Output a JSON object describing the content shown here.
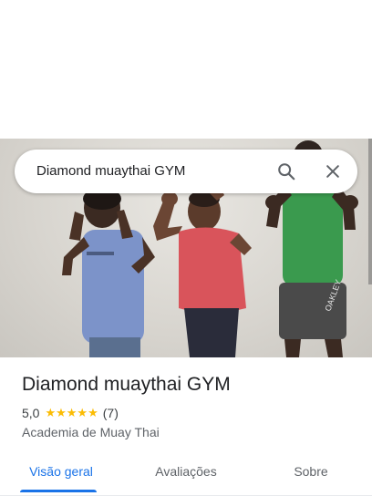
{
  "search": {
    "query": "Diamond muaythai GYM"
  },
  "icons": {
    "search": "search-icon",
    "close": "close-icon",
    "star": "star-icon"
  },
  "place": {
    "name": "Diamond muaythai GYM",
    "rating": "5,0",
    "stars": "★★★★★",
    "review_count": "(7)",
    "category": "Academia de Muay Thai"
  },
  "tabs": [
    {
      "label": "Visão geral",
      "active": true
    },
    {
      "label": "Avaliações",
      "active": false
    },
    {
      "label": "Sobre",
      "active": false
    }
  ],
  "colors": {
    "accent": "#1a73e8",
    "star": "#fbbc04",
    "shirt_left": "#7c93c9",
    "shirt_middle": "#d9545b",
    "shirt_right": "#3a9a4e"
  }
}
